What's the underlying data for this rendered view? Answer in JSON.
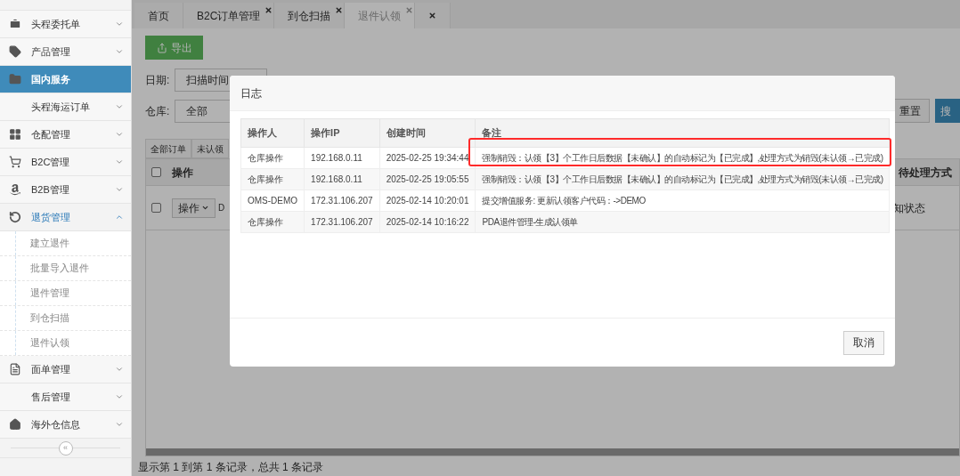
{
  "sidebar": {
    "items": [
      {
        "label": "头程委托单",
        "selected": false,
        "expanded": false
      },
      {
        "label": "产品管理",
        "selected": false,
        "expanded": false
      },
      {
        "label": "国内服务",
        "selected": true
      },
      {
        "label": "头程海运订单",
        "selected": false,
        "expanded": false
      },
      {
        "label": "仓配管理",
        "selected": false,
        "expanded": false
      },
      {
        "label": "B2C管理",
        "selected": false,
        "expanded": false
      },
      {
        "label": "B2B管理",
        "selected": false,
        "expanded": false
      },
      {
        "label": "退货管理",
        "selected": false,
        "expanded": true,
        "children": [
          {
            "label": "建立退件"
          },
          {
            "label": "批量导入退件"
          },
          {
            "label": "退件管理"
          },
          {
            "label": "到仓扫描"
          },
          {
            "label": "退件认领"
          }
        ]
      },
      {
        "label": "面单管理",
        "selected": false,
        "expanded": false
      },
      {
        "label": "售后管理",
        "selected": false,
        "expanded": false
      },
      {
        "label": "海外仓信息",
        "selected": false,
        "expanded": false
      }
    ],
    "collapse": "«"
  },
  "tabs": [
    {
      "label": "首页",
      "selected": false,
      "closable": false
    },
    {
      "label": "B2C订单管理",
      "selected": false,
      "closable": true
    },
    {
      "label": "到仓扫描",
      "selected": false,
      "closable": true
    },
    {
      "label": "退件认领",
      "selected": true,
      "closable": true
    },
    {
      "selected": false,
      "closable": true
    }
  ],
  "toolbar": {
    "export": "导出",
    "date_label": "日期:",
    "date_select": "扫描时间",
    "warehouse_label": "仓库:",
    "warehouse_select": "全部",
    "reset": "重置",
    "search": "搜"
  },
  "list_tabs": [
    "全部订单",
    "未认领"
  ],
  "table": {
    "columns": [
      "操作",
      "待处理方式"
    ],
    "header_checked": false,
    "row": {
      "checked": false,
      "action": "操作",
      "cell_1": "D",
      "cell_2": "知状态"
    }
  },
  "pagination": "显示第 1 到第 1 条记录，总共 1 条记录",
  "dialog": {
    "title": "日志",
    "columns": [
      "操作人",
      "操作IP",
      "创建时间",
      "备注"
    ],
    "rows": [
      [
        "仓库操作",
        "192.168.0.11",
        "2025-02-25 19:34:44",
        "强制销毁：认领【3】个工作日后数据【未确认】的自动标记为【已完成】,处理方式为销毁(未认领→已完成)"
      ],
      [
        "仓库操作",
        "192.168.0.11",
        "2025-02-25 19:05:55",
        "强制销毁：认领【3】个工作日后数据【未确认】的自动标记为【已完成】,处理方式为销毁(未认领→已完成)"
      ],
      [
        "OMS-DEMO",
        "172.31.106.207",
        "2025-02-14 10:20:01",
        "提交增值服务: 更新认领客户代码：->DEMO"
      ],
      [
        "仓库操作",
        "172.31.106.207",
        "2025-02-14 10:16:22",
        "PDA退件管理-生成认领单"
      ]
    ],
    "cancel": "取消"
  }
}
